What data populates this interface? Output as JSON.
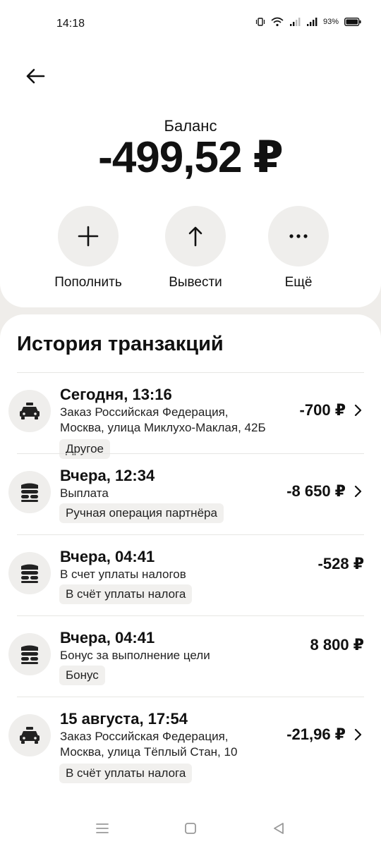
{
  "status_bar": {
    "time": "14:18",
    "battery": "93%"
  },
  "balance": {
    "label": "Баланс",
    "value": "-499,52 ₽"
  },
  "actions": [
    {
      "label": "Пополнить",
      "icon": "plus-icon"
    },
    {
      "label": "Вывести",
      "icon": "arrow-up-icon"
    },
    {
      "label": "Ещё",
      "icon": "more-icon"
    }
  ],
  "history": {
    "title": "История транзакций",
    "items": [
      {
        "icon": "taxi-icon",
        "date": "Сегодня, 13:16",
        "desc": "Заказ Российская Федерация, Москва, улица Миклухо-Маклая, 42Б",
        "tag": "Другое",
        "amount": "-700 ₽",
        "has_chevron": true
      },
      {
        "icon": "payout-icon",
        "date": "Вчера, 12:34",
        "desc": "Выплата",
        "tag": "Ручная операция партнёра",
        "amount": "-8 650 ₽",
        "has_chevron": true
      },
      {
        "icon": "payout-icon",
        "date": "Вчера, 04:41",
        "desc": "В счет уплаты налогов",
        "tag": "В счёт уплаты налога",
        "amount": "-528 ₽",
        "has_chevron": false
      },
      {
        "icon": "payout-icon",
        "date": "Вчера, 04:41",
        "desc": "Бонус за выполнение цели",
        "tag": "Бонус",
        "amount": "8 800 ₽",
        "has_chevron": false
      },
      {
        "icon": "taxi-icon",
        "date": "15 августа, 17:54",
        "desc": "Заказ Российская Федерация, Москва, улица Тёплый Стан, 10",
        "tag": "В счёт уплаты налога",
        "amount": "-21,96 ₽",
        "has_chevron": true
      }
    ]
  },
  "colors": {
    "background": "#efedea",
    "card": "#ffffff",
    "circle": "#efeeec",
    "tag": "#f1f0ee"
  }
}
